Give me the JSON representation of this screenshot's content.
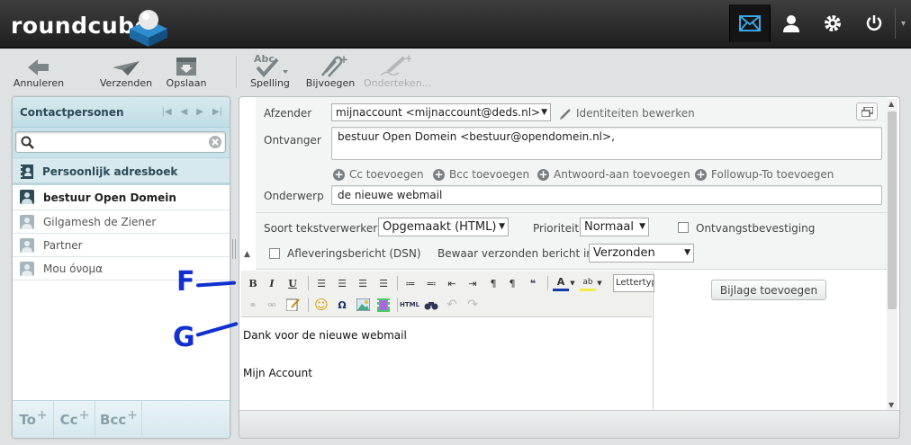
{
  "header": {
    "logo": "roundcube",
    "nav": [
      {
        "icon": "mail-icon",
        "active": true
      },
      {
        "icon": "contacts-icon",
        "active": false
      },
      {
        "icon": "settings-icon",
        "active": false
      },
      {
        "icon": "logout-icon",
        "active": false
      }
    ]
  },
  "toolbar": {
    "cancel": "Annuleren",
    "send": "Verzenden",
    "save": "Opslaan",
    "spelling": "Spelling",
    "attach": "Bijvoegen",
    "signature": "Onderteken..."
  },
  "contacts": {
    "title": "Contactpersonen",
    "search_value": "",
    "addressbook": "Persoonlijk adresboek",
    "items": [
      {
        "name": "bestuur Open Domein",
        "selected": true
      },
      {
        "name": "Gilgamesh de Ziener",
        "selected": false
      },
      {
        "name": "Partner",
        "selected": false
      },
      {
        "name": "Mou όνομα",
        "selected": false
      }
    ],
    "footer": {
      "to": "To",
      "cc": "Cc",
      "bcc": "Bcc",
      "plus": "+"
    }
  },
  "compose": {
    "from_label": "Afzender",
    "from_value": "mijnaccount <mijnaccount@deds.nl>",
    "edit_identities": "Identiteiten bewerken",
    "to_label": "Ontvanger",
    "to_value": "bestuur Open Domein <bestuur@opendomein.nl>,",
    "add_cc": "Cc toevoegen",
    "add_bcc": "Bcc toevoegen",
    "add_replyto": "Antwoord-aan toevoegen",
    "add_followup": "Followup-To toevoegen",
    "subject_label": "Onderwerp",
    "subject_value": "de nieuwe webmail",
    "editor_type_label": "Soort tekstverwerker",
    "editor_type_value": "Opgemaakt (HTML)",
    "priority_label": "Prioriteit",
    "priority_value": "Normaal",
    "receipt_label": "Ontvangstbevestiging",
    "dsn_label": "Afleveringsbericht (DSN)",
    "save_in_label": "Bewaar verzonden bericht in",
    "save_in_value": "Verzonden",
    "font_select": "Lettertype",
    "body_line1": "Dank voor de nieuwe webmail",
    "body_line2": "Mijn Account",
    "attach_button": "Bijlage toevoegen"
  },
  "annotations": {
    "f": "F",
    "g": "G"
  },
  "colors": {
    "accent": "#2c4a57",
    "annotation": "#1030d0"
  }
}
